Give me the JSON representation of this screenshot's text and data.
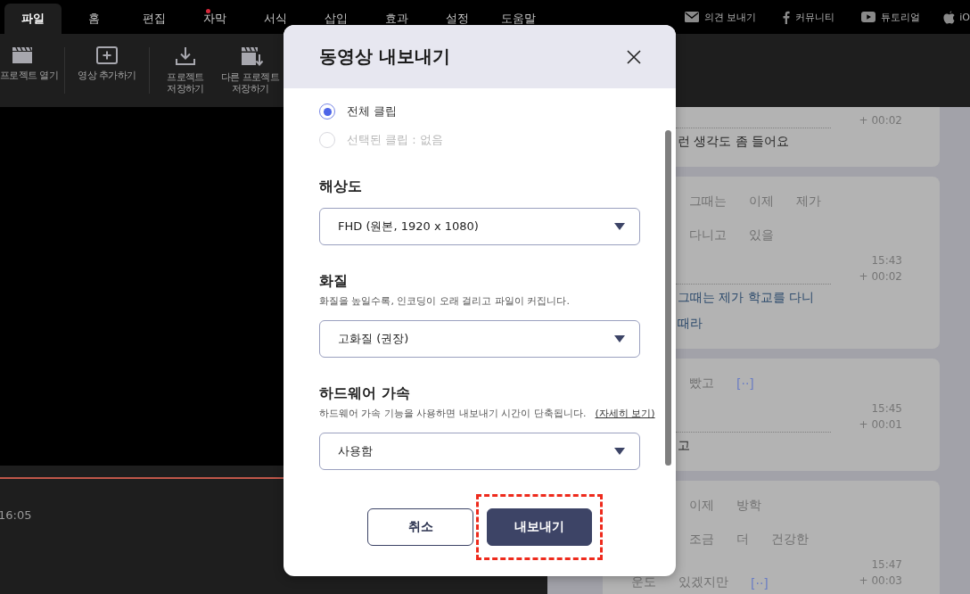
{
  "menu_tabs": [
    {
      "label": "파일",
      "selected": true,
      "badge": false
    },
    {
      "label": "홈",
      "selected": false,
      "badge": false
    },
    {
      "label": "편집",
      "selected": false,
      "badge": false
    },
    {
      "label": "자막",
      "selected": false,
      "badge": true
    },
    {
      "label": "서식",
      "selected": false,
      "badge": false
    },
    {
      "label": "삽입",
      "selected": false,
      "badge": false
    },
    {
      "label": "효과",
      "selected": false,
      "badge": false
    },
    {
      "label": "설정",
      "selected": false,
      "badge": false
    },
    {
      "label": "도움말",
      "selected": false,
      "badge": false
    }
  ],
  "header_links": [
    {
      "label": "의견 보내기",
      "kind": "mail"
    },
    {
      "label": "커뮤니티",
      "kind": "facebook"
    },
    {
      "label": "튜토리얼",
      "kind": "video"
    },
    {
      "label": "iO",
      "kind": "apple"
    }
  ],
  "toolbar": [
    {
      "label": "프로젝트 열기",
      "kind": "open"
    },
    {
      "label": "영상 추가하기",
      "kind": "add"
    },
    {
      "label": "프로젝트\n저장하기",
      "kind": "save"
    },
    {
      "label": "다른 프로젝트\n저장하기",
      "kind": "save_as"
    }
  ],
  "player": {
    "timecode": "16:05"
  },
  "subtitle_cards": [
    {
      "duration": "+ 00:02",
      "lines": [
        "런 생각도 좀 들어요"
      ],
      "active": false
    },
    {
      "rows": [
        [
          {
            "text": "",
            "kind": "word"
          },
          {
            "text": "그때는",
            "kind": "word"
          },
          {
            "text": "이제",
            "kind": "word"
          },
          {
            "text": "제가",
            "kind": "word"
          }
        ],
        [
          {
            "text": "",
            "kind": "word"
          },
          {
            "text": "다니고",
            "kind": "word"
          },
          {
            "text": "있을",
            "kind": "word"
          }
        ]
      ],
      "time": "15:43",
      "duration": "+ 00:02",
      "lines": [
        "그때는 제가 학교를 다니",
        "때라"
      ],
      "active": true
    },
    {
      "rows": [
        [
          {
            "text": "",
            "kind": "word"
          },
          {
            "text": "빴고",
            "kind": "word"
          },
          {
            "text": "[··]",
            "kind": "gap"
          }
        ]
      ],
      "time": "15:45",
      "duration": "+ 00:01",
      "lines": [
        "고"
      ],
      "active": false
    },
    {
      "rows": [
        [
          {
            "text": "",
            "kind": "word"
          },
          {
            "text": "이제",
            "kind": "word"
          },
          {
            "text": "방학",
            "kind": "word"
          }
        ],
        [
          {
            "text": "",
            "kind": "word"
          },
          {
            "text": "조금",
            "kind": "word"
          },
          {
            "text": "더",
            "kind": "word"
          },
          {
            "text": "건강한",
            "kind": "word"
          }
        ],
        [
          {
            "text": "운도",
            "kind": "word"
          },
          {
            "text": "있겠지만",
            "kind": "word"
          },
          {
            "text": "[··]",
            "kind": "gap"
          }
        ]
      ],
      "time": "15:47",
      "duration": "+ 00:03"
    }
  ],
  "dialog": {
    "title": "동영상 내보내기",
    "scope_options": [
      {
        "label": "전체 클립",
        "selected": true,
        "disabled": false
      },
      {
        "label": "선택된 클립 : 없음",
        "selected": false,
        "disabled": true
      }
    ],
    "settings": [
      {
        "heading": "해상도",
        "value": "FHD (원본, 1920 x 1080)"
      },
      {
        "heading": "화질",
        "description": "화질을 높일수록, 인코딩이 오래 걸리고 파일이 커집니다.",
        "value": "고화질 (권장)"
      },
      {
        "heading": "하드웨어 가속",
        "description": "하드웨어 가속 기능을 사용하면 내보내기 시간이 단축됩니다.",
        "link": "(자세히 보기)",
        "value": "사용함"
      }
    ],
    "buttons": [
      {
        "label": "취소",
        "kind": "secondary"
      },
      {
        "label": "내보내기",
        "kind": "primary",
        "highlighted": true
      }
    ]
  }
}
